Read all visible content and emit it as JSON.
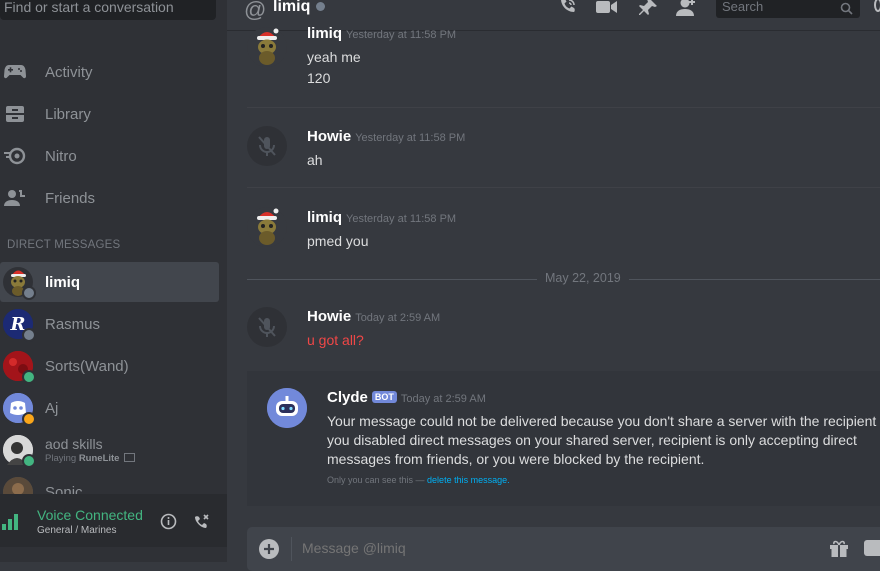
{
  "sidebar": {
    "search_placeholder": "Find or start a conversation",
    "nav": [
      {
        "label": "Activity",
        "icon": "gamepad-icon"
      },
      {
        "label": "Library",
        "icon": "library-icon"
      },
      {
        "label": "Nitro",
        "icon": "nitro-icon"
      },
      {
        "label": "Friends",
        "icon": "friends-icon"
      }
    ],
    "dm_header": "DIRECT MESSAGES",
    "dms": [
      {
        "name": "limiq",
        "status": "offline",
        "active": true
      },
      {
        "name": "Rasmus",
        "status": "offline"
      },
      {
        "name": "Sorts(Wand)",
        "status": "online"
      },
      {
        "name": "Aj",
        "status": "idle"
      },
      {
        "name": "aod skills",
        "status": "online",
        "activity_prefix": "Playing",
        "activity_game": "RuneLite"
      },
      {
        "name": "Sonic",
        "status": "online"
      }
    ],
    "voice": {
      "title": "Voice Connected",
      "subtitle": "General / Marines"
    }
  },
  "header": {
    "channel_name": "limiq",
    "search_placeholder": "Search"
  },
  "messages": [
    {
      "author": "limiq",
      "time": "Yesterday at 11:58 PM",
      "lines": [
        "yeah me",
        "120"
      ]
    },
    {
      "author": "Howie",
      "time": "Yesterday at 11:58 PM",
      "lines": [
        "ah"
      ]
    },
    {
      "author": "limiq",
      "time": "Yesterday at 11:58 PM",
      "lines": [
        "pmed you"
      ]
    },
    {
      "author": "Howie",
      "time": "Today at 2:59 AM",
      "lines": [
        "u got all?"
      ]
    }
  ],
  "date_separator": "May 22, 2019",
  "clyde": {
    "author": "Clyde",
    "tag": "BOT",
    "time": "Today at 2:59 AM",
    "lines": [
      "Your message could not be delivered because you don't share a server with the recipient or",
      "you disabled direct messages on your shared server, recipient is only accepting direct",
      "messages from friends, or you were blocked by the recipient."
    ],
    "note_prefix": "Only you can see this — ",
    "note_link": "delete this message."
  },
  "composer": {
    "placeholder": "Message @limiq"
  },
  "colors": {
    "online": "#43b581",
    "idle": "#faa61a",
    "offline": "#747f8d",
    "error_text": "#f04747",
    "link": "#00b0f4",
    "blurple": "#7289da"
  }
}
